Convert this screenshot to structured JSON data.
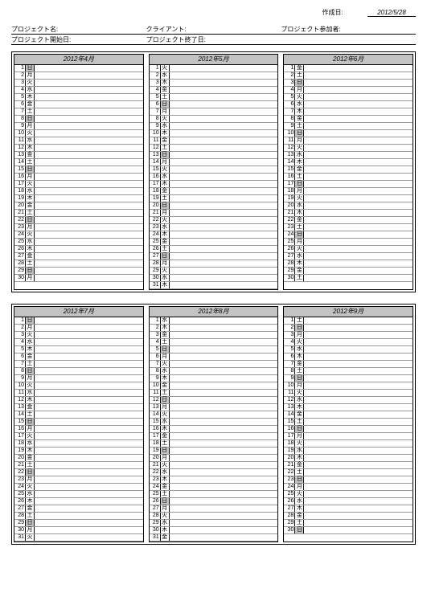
{
  "header": {
    "date_label": "作成日:",
    "date_value": "2012/5/28"
  },
  "meta": {
    "row1": {
      "c1_label": "プロジェクト名:",
      "c1_value": "",
      "c2_label": "クライアント:",
      "c2_value": "",
      "c3_label": "プロジェクト参加者:",
      "c3_value": ""
    },
    "row2": {
      "c1_label": "プロジェクト開始日:",
      "c1_value": "",
      "c2_label": "プロジェクト終了日:",
      "c2_value": "",
      "c3_label": "",
      "c3_value": ""
    }
  },
  "dow": [
    "日",
    "月",
    "火",
    "水",
    "木",
    "金",
    "土"
  ],
  "months": [
    {
      "title": "2012年4月",
      "days": 30,
      "startDow": 0
    },
    {
      "title": "2012年5月",
      "days": 31,
      "startDow": 2
    },
    {
      "title": "2012年6月",
      "days": 30,
      "startDow": 5
    },
    {
      "title": "2012年7月",
      "days": 31,
      "startDow": 0
    },
    {
      "title": "2012年8月",
      "days": 31,
      "startDow": 3
    },
    {
      "title": "2012年9月",
      "days": 30,
      "startDow": 6
    }
  ]
}
